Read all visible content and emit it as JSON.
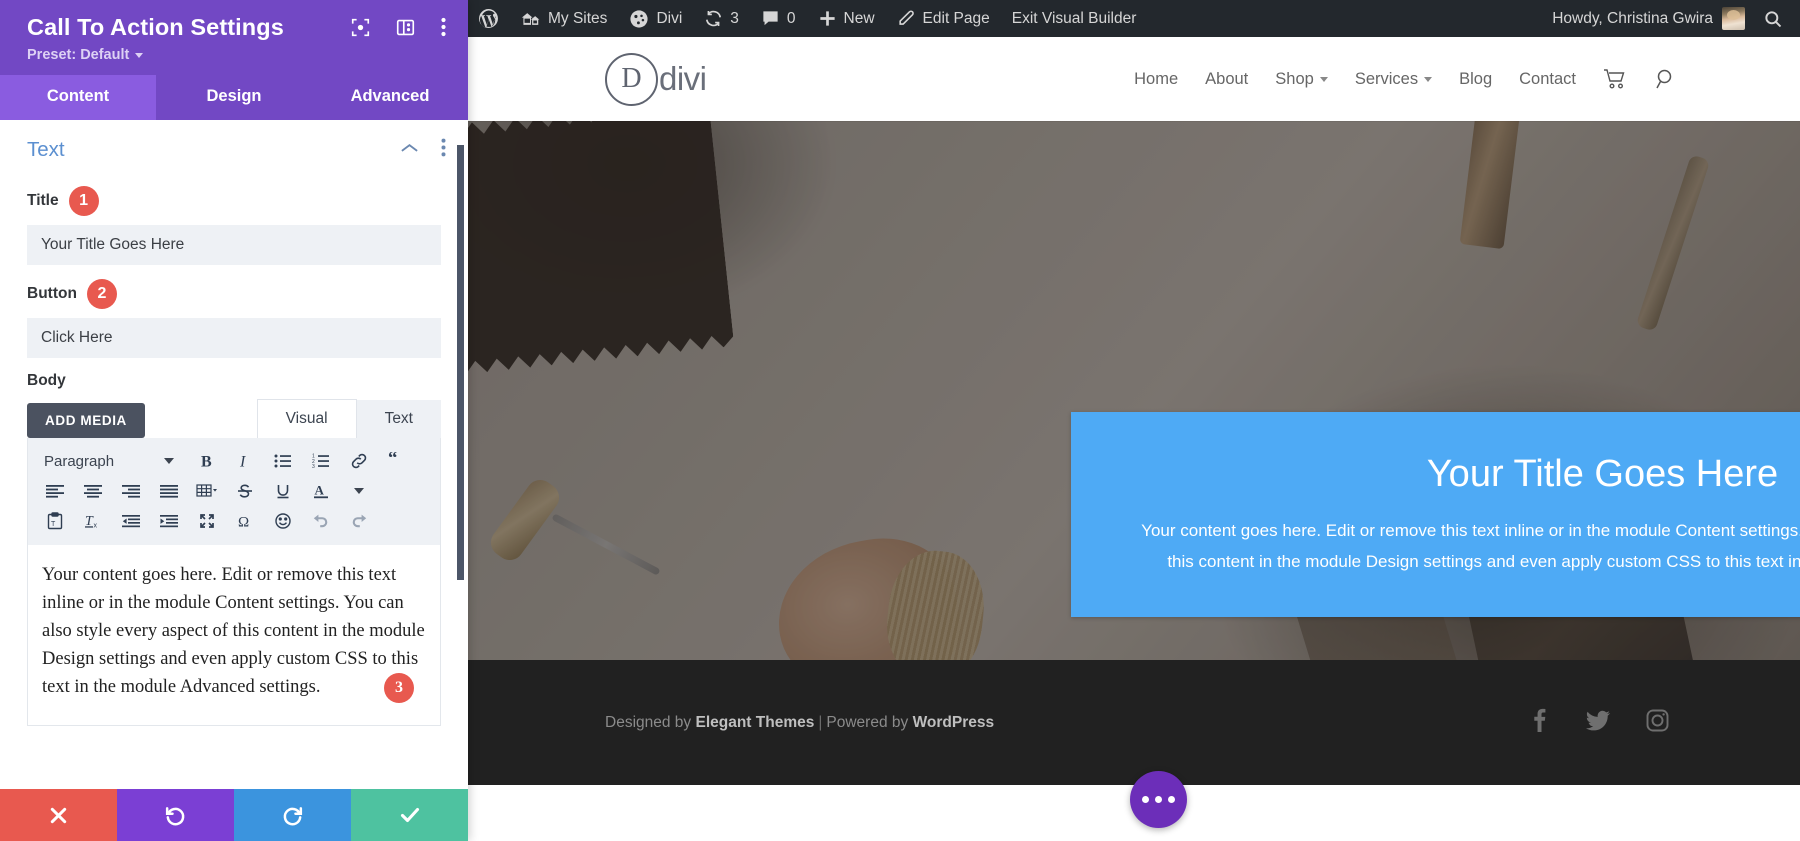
{
  "adminbar": {
    "items": [
      {
        "icon": "wordpress-logo-icon",
        "label": ""
      },
      {
        "icon": "my-sites-icon",
        "label": "My Sites"
      },
      {
        "icon": "divi-icon",
        "label": "Divi"
      },
      {
        "icon": "updates-icon",
        "label": "3"
      },
      {
        "icon": "comments-icon",
        "label": "0"
      },
      {
        "icon": "plus-icon",
        "label": "New"
      },
      {
        "icon": "edit-pencil-icon",
        "label": "Edit Page"
      },
      {
        "icon": "",
        "label": "Exit Visual Builder"
      }
    ],
    "howdy": "Howdy, Christina Gwira",
    "search_icon": "search-icon"
  },
  "site_header": {
    "logo_letter": "D",
    "logo_word": "divi",
    "nav": [
      {
        "label": "Home",
        "has_dropdown": false
      },
      {
        "label": "About",
        "has_dropdown": false
      },
      {
        "label": "Shop",
        "has_dropdown": true
      },
      {
        "label": "Services",
        "has_dropdown": true
      },
      {
        "label": "Blog",
        "has_dropdown": false
      },
      {
        "label": "Contact",
        "has_dropdown": false
      }
    ],
    "cart_icon": "shopping-cart-icon",
    "search_icon": "search-icon"
  },
  "cta_module": {
    "title": "Your Title Goes Here",
    "body": "Your content goes here. Edit or remove this text inline or in the module Content settings. You can also style every aspect of this content in the module Design settings and even apply custom CSS to this text in the module Advanced settings.",
    "background_color": "#4eaaf5"
  },
  "site_footer": {
    "designed_by": "Designed by",
    "elegant_themes": "Elegant Themes",
    "separator": "|",
    "powered_by": "Powered by",
    "wordpress": "WordPress",
    "social": [
      "facebook-icon",
      "twitter-icon",
      "instagram-icon"
    ]
  },
  "fab": {
    "icon": "ellipsis-icon"
  },
  "panel": {
    "title": "Call To Action Settings",
    "preset_label": "Preset: Default",
    "header_icons": [
      "focus-frame-icon",
      "layout-panel-icon",
      "kebab-menu-icon"
    ],
    "tabs": [
      {
        "label": "Content",
        "active": true
      },
      {
        "label": "Design",
        "active": false
      },
      {
        "label": "Advanced",
        "active": false
      }
    ],
    "section": {
      "title": "Text",
      "collapse_icon": "chevron-up-icon",
      "menu_icon": "kebab-menu-icon"
    },
    "fields": {
      "title": {
        "label": "Title",
        "badge": "1",
        "value": "Your Title Goes Here",
        "placeholder": "Your Title Goes Here"
      },
      "button": {
        "label": "Button",
        "badge": "2",
        "value": "Click Here",
        "placeholder": "Click Here"
      },
      "body": {
        "label": "Body",
        "badge": "3",
        "add_media_label": "ADD MEDIA",
        "editor_tabs": [
          {
            "label": "Visual",
            "active": true
          },
          {
            "label": "Text",
            "active": false
          }
        ],
        "format_select": "Paragraph",
        "toolbar_row1": [
          "bold-icon",
          "italic-icon",
          "bulleted-list-icon",
          "numbered-list-icon",
          "link-icon",
          "blockquote-icon"
        ],
        "toolbar_row2": [
          "align-left-icon",
          "align-center-icon",
          "align-right-icon",
          "align-justify-icon",
          "table-icon",
          "strikethrough-icon",
          "underline-icon",
          "text-color-icon"
        ],
        "toolbar_row3": [
          "paste-as-text-icon",
          "clear-formatting-icon",
          "outdent-icon",
          "indent-icon",
          "fullscreen-icon",
          "special-character-icon",
          "emoji-icon",
          "undo-icon",
          "redo-icon"
        ],
        "content": "Your content goes here. Edit or remove this text inline or in the module Content settings. You can also style every aspect of this content in the module Design settings and even apply custom CSS to this text in the module Advanced settings."
      }
    },
    "actions": [
      {
        "name": "discard",
        "icon": "close-x-icon",
        "color": "#e8594f"
      },
      {
        "name": "undo",
        "icon": "undo-arrow-icon",
        "color": "#7b3fd4"
      },
      {
        "name": "redo",
        "icon": "redo-arrow-icon",
        "color": "#3b94de"
      },
      {
        "name": "save",
        "icon": "checkmark-icon",
        "color": "#4ec2a0"
      }
    ]
  }
}
